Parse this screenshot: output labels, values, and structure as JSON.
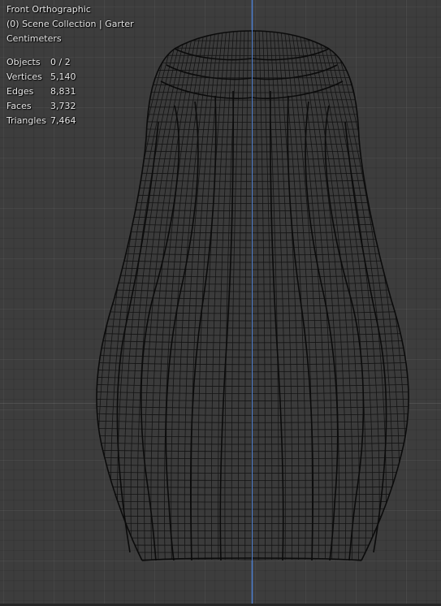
{
  "viewport": {
    "view_name": "Front Orthographic",
    "collection": "(0) Scene Collection | Garter",
    "units": "Centimeters"
  },
  "stats": [
    {
      "label": "Objects",
      "value": "0 / 2"
    },
    {
      "label": "Vertices",
      "value": "5,140"
    },
    {
      "label": "Edges",
      "value": "8,831"
    },
    {
      "label": "Faces",
      "value": "3,732"
    },
    {
      "label": "Triangles",
      "value": "7,464"
    }
  ],
  "colors": {
    "background": "#3d3d3d",
    "grid": "#474747",
    "wire": "#0d0d0d",
    "axis_z": "#4e7fd0",
    "text": "#e8e8e8"
  }
}
